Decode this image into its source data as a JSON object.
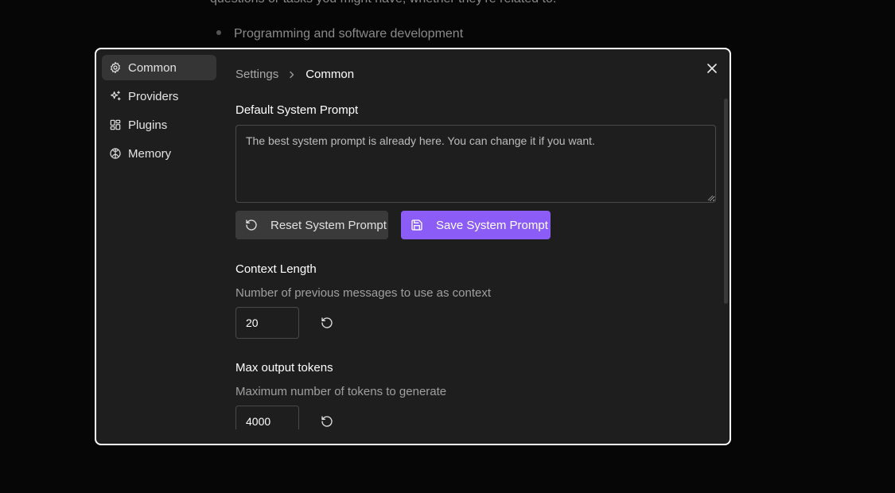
{
  "background": {
    "paragraph": "questions or tasks you might have, whether they're related to:",
    "bullet": "Programming and software development"
  },
  "sidebar": {
    "items": [
      {
        "label": "Common",
        "icon": "gear-icon",
        "active": true
      },
      {
        "label": "Providers",
        "icon": "sparkles-icon",
        "active": false
      },
      {
        "label": "Plugins",
        "icon": "grid-icon",
        "active": false
      },
      {
        "label": "Memory",
        "icon": "brain-icon",
        "active": false
      }
    ]
  },
  "breadcrumb": {
    "parent": "Settings",
    "current": "Common"
  },
  "system_prompt": {
    "title": "Default System Prompt",
    "value": "The best system prompt is already here. You can change it if you want.",
    "reset_label": "Reset System Prompt",
    "save_label": "Save System Prompt"
  },
  "context_length": {
    "title": "Context Length",
    "description": "Number of previous messages to use as context",
    "value": "20"
  },
  "max_tokens": {
    "title": "Max output tokens",
    "description": "Maximum number of tokens to generate",
    "value": "4000"
  },
  "colors": {
    "accent": "#8b5cf6",
    "modal_bg": "#1e1e1f",
    "active_nav": "#353536"
  }
}
